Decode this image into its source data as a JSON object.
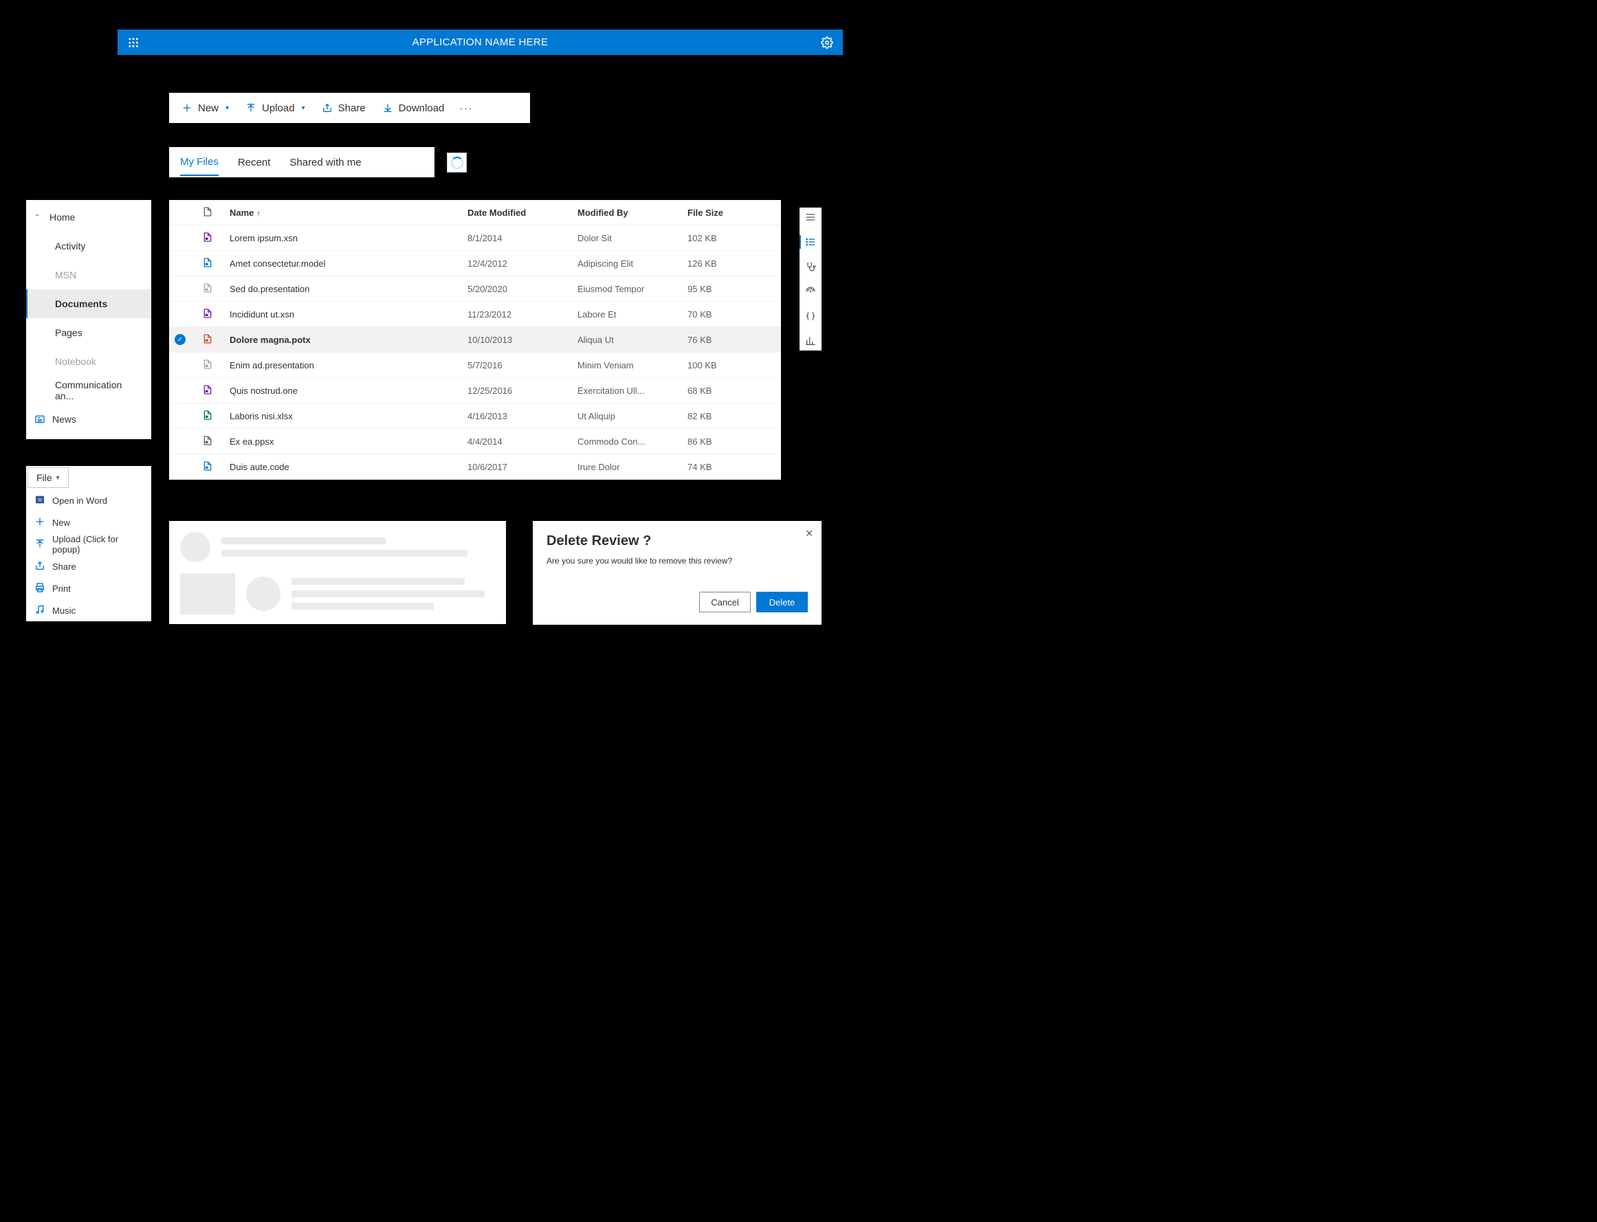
{
  "header": {
    "title": "APPLICATION NAME HERE"
  },
  "commandbar": {
    "new": "New",
    "upload": "Upload",
    "share": "Share",
    "download": "Download"
  },
  "tabs": {
    "items": [
      {
        "label": "My Files",
        "active": true
      },
      {
        "label": "Recent",
        "active": false
      },
      {
        "label": "Shared with me",
        "active": false
      }
    ]
  },
  "nav": {
    "items": [
      {
        "label": "Home",
        "kind": "root"
      },
      {
        "label": "Activity",
        "kind": "child"
      },
      {
        "label": "MSN",
        "kind": "child-disabled"
      },
      {
        "label": "Documents",
        "kind": "child-selected"
      },
      {
        "label": "Pages",
        "kind": "child"
      },
      {
        "label": "Notebook",
        "kind": "child-disabled"
      },
      {
        "label": "Communication an...",
        "kind": "child"
      },
      {
        "label": "News",
        "kind": "news"
      }
    ]
  },
  "files": {
    "columns": {
      "name": "Name",
      "date": "Date Modified",
      "by": "Modified By",
      "size": "File Size"
    },
    "rows": [
      {
        "icon": "xsn",
        "name": "Lorem ipsum.xsn",
        "date": "8/1/2014",
        "by": "Dolor Sit",
        "size": "102 KB",
        "selected": false
      },
      {
        "icon": "model",
        "name": "Amet consectetur.model",
        "date": "12/4/2012",
        "by": "Adipiscing Elit",
        "size": "126 KB",
        "selected": false
      },
      {
        "icon": "pres",
        "name": "Sed do.presentation",
        "date": "5/20/2020",
        "by": "Eiusmod Tempor",
        "size": "95 KB",
        "selected": false
      },
      {
        "icon": "xsn",
        "name": "Incididunt ut.xsn",
        "date": "11/23/2012",
        "by": "Labore Et",
        "size": "70 KB",
        "selected": false
      },
      {
        "icon": "potx",
        "name": "Dolore magna.potx",
        "date": "10/10/2013",
        "by": "Aliqua Ut",
        "size": "76 KB",
        "selected": true
      },
      {
        "icon": "pres",
        "name": "Enim ad.presentation",
        "date": "5/7/2016",
        "by": "Minim Veniam",
        "size": "100 KB",
        "selected": false
      },
      {
        "icon": "one",
        "name": "Quis nostrud.one",
        "date": "12/25/2016",
        "by": "Exercitation Ull...",
        "size": "68 KB",
        "selected": false
      },
      {
        "icon": "xlsx",
        "name": "Laboris nisi.xlsx",
        "date": "4/16/2013",
        "by": "Ut Aliquip",
        "size": "82 KB",
        "selected": false
      },
      {
        "icon": "ppsx",
        "name": "Ex ea.ppsx",
        "date": "4/4/2014",
        "by": "Commodo Con...",
        "size": "86 KB",
        "selected": false
      },
      {
        "icon": "code",
        "name": "Duis aute.code",
        "date": "10/6/2017",
        "by": "Irure Dolor",
        "size": "74 KB",
        "selected": false
      }
    ]
  },
  "dropdown": {
    "toggle": "File",
    "items": [
      {
        "icon": "word",
        "label": "Open in Word"
      },
      {
        "icon": "plus",
        "label": "New"
      },
      {
        "icon": "upload",
        "label": "Upload (Click for popup)"
      },
      {
        "icon": "share",
        "label": "Share"
      },
      {
        "icon": "print",
        "label": "Print"
      },
      {
        "icon": "music",
        "label": "Music"
      }
    ]
  },
  "dialog": {
    "title": "Delete Review ?",
    "body": "Are you sure you would like to remove this review?",
    "cancel": "Cancel",
    "confirm": "Delete"
  },
  "colors": {
    "accent": "#0078d4"
  }
}
